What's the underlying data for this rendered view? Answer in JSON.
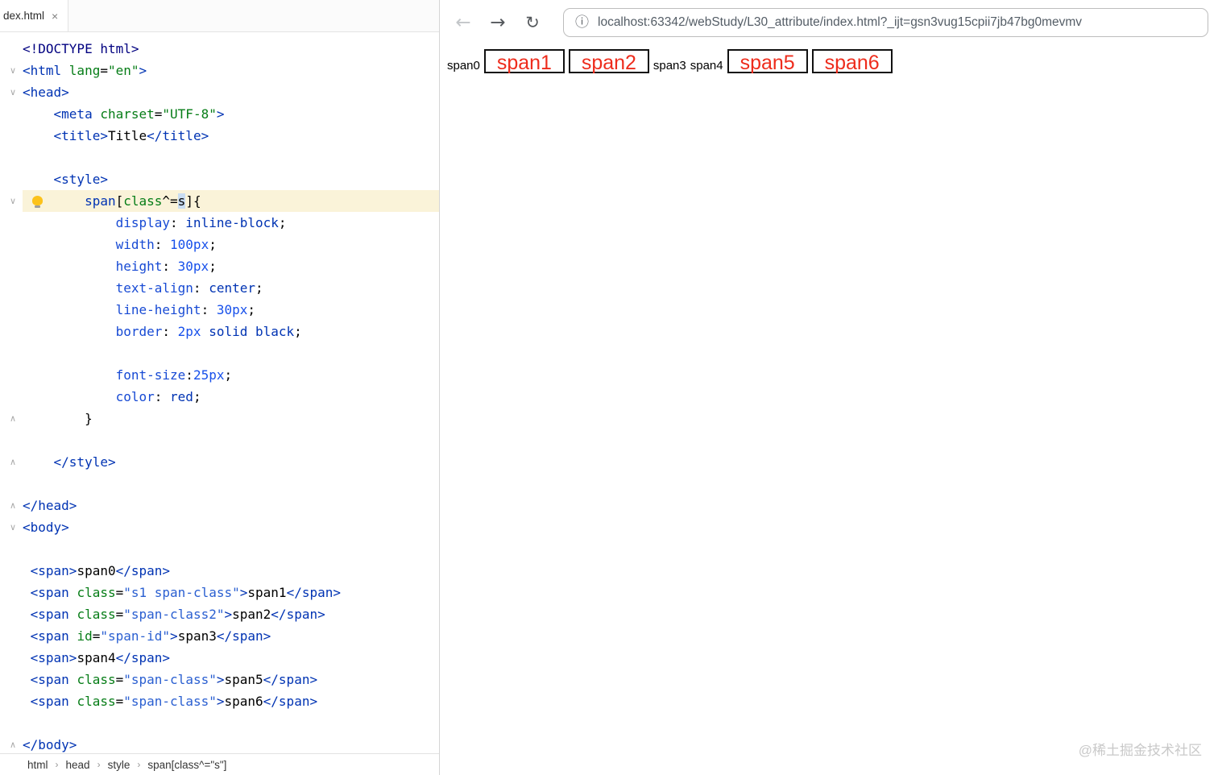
{
  "colors": {
    "doctype": "#000080",
    "tag": "#0033b3",
    "attr_name": "#067d17",
    "attr_value": "#067d17",
    "class_value": "#2a5fd1",
    "css_selector": "#0033b3",
    "css_attr_name": "#067d17",
    "css_property": "#174ad4",
    "css_value": "#0033b3",
    "css_number": "#1750eb",
    "selection_bg": "#c9ddf2",
    "line_highlight": "#faf3d9",
    "red_text": "#ee2c1c",
    "box_border": "#111111",
    "url_text": "#545d66",
    "watermark": "#c9c9c9"
  },
  "editor": {
    "tab": {
      "label": "dex.html",
      "close_icon": "×"
    },
    "icons": {
      "fold_down": "∨",
      "fold_up": "∧"
    },
    "highlight_line": 8,
    "bulb_line": 8,
    "gutter_marks": [
      {
        "line": 2,
        "type": "down"
      },
      {
        "line": 3,
        "type": "down"
      },
      {
        "line": 8,
        "type": "down"
      },
      {
        "line": 18,
        "type": "up"
      },
      {
        "line": 20,
        "type": "up"
      },
      {
        "line": 22,
        "type": "up"
      },
      {
        "line": 23,
        "type": "down"
      },
      {
        "line": 33,
        "type": "up"
      }
    ],
    "lines": [
      {
        "tokens": [
          [
            "doctype",
            "<!DOCTYPE html>"
          ]
        ]
      },
      {
        "tokens": [
          [
            "tag",
            "<html "
          ],
          [
            "attr",
            "lang"
          ],
          [
            "plain",
            "="
          ],
          [
            "str",
            "\"en\""
          ],
          [
            "tag",
            ">"
          ]
        ]
      },
      {
        "tokens": [
          [
            "tag",
            "<head>"
          ]
        ]
      },
      {
        "tokens": [
          [
            "plain",
            "    "
          ],
          [
            "tag",
            "<meta "
          ],
          [
            "attr",
            "charset"
          ],
          [
            "plain",
            "="
          ],
          [
            "str",
            "\"UTF-8\""
          ],
          [
            "tag",
            ">"
          ]
        ]
      },
      {
        "tokens": [
          [
            "plain",
            "    "
          ],
          [
            "tag",
            "<title>"
          ],
          [
            "plain",
            "Title"
          ],
          [
            "tag",
            "</title>"
          ]
        ]
      },
      {
        "tokens": []
      },
      {
        "tokens": [
          [
            "plain",
            "    "
          ],
          [
            "tag",
            "<style>"
          ]
        ]
      },
      {
        "tokens": [
          [
            "plain",
            "        "
          ],
          [
            "cssel",
            "span"
          ],
          [
            "plain",
            "["
          ],
          [
            "cssattr",
            "class"
          ],
          [
            "plain",
            "^="
          ],
          [
            "sel",
            "s"
          ],
          [
            "plain",
            "]{"
          ]
        ]
      },
      {
        "tokens": [
          [
            "plain",
            "            "
          ],
          [
            "prop",
            "display"
          ],
          [
            "plain",
            ": "
          ],
          [
            "val",
            "inline-block"
          ],
          [
            "plain",
            ";"
          ]
        ]
      },
      {
        "tokens": [
          [
            "plain",
            "            "
          ],
          [
            "prop",
            "width"
          ],
          [
            "plain",
            ": "
          ],
          [
            "num",
            "100px"
          ],
          [
            "plain",
            ";"
          ]
        ]
      },
      {
        "tokens": [
          [
            "plain",
            "            "
          ],
          [
            "prop",
            "height"
          ],
          [
            "plain",
            ": "
          ],
          [
            "num",
            "30px"
          ],
          [
            "plain",
            ";"
          ]
        ]
      },
      {
        "tokens": [
          [
            "plain",
            "            "
          ],
          [
            "prop",
            "text-align"
          ],
          [
            "plain",
            ": "
          ],
          [
            "val",
            "center"
          ],
          [
            "plain",
            ";"
          ]
        ]
      },
      {
        "tokens": [
          [
            "plain",
            "            "
          ],
          [
            "prop",
            "line-height"
          ],
          [
            "plain",
            ": "
          ],
          [
            "num",
            "30px"
          ],
          [
            "plain",
            ";"
          ]
        ]
      },
      {
        "tokens": [
          [
            "plain",
            "            "
          ],
          [
            "prop",
            "border"
          ],
          [
            "plain",
            ": "
          ],
          [
            "num",
            "2px"
          ],
          [
            "val",
            " solid black"
          ],
          [
            "plain",
            ";"
          ]
        ]
      },
      {
        "tokens": []
      },
      {
        "tokens": [
          [
            "plain",
            "            "
          ],
          [
            "prop",
            "font-size"
          ],
          [
            "plain",
            ":"
          ],
          [
            "num",
            "25px"
          ],
          [
            "plain",
            ";"
          ]
        ]
      },
      {
        "tokens": [
          [
            "plain",
            "            "
          ],
          [
            "prop",
            "color"
          ],
          [
            "plain",
            ": "
          ],
          [
            "val",
            "red"
          ],
          [
            "plain",
            ";"
          ]
        ]
      },
      {
        "tokens": [
          [
            "plain",
            "        }"
          ]
        ]
      },
      {
        "tokens": []
      },
      {
        "tokens": [
          [
            "plain",
            "    "
          ],
          [
            "tag",
            "</style>"
          ]
        ]
      },
      {
        "tokens": []
      },
      {
        "tokens": [
          [
            "tag",
            "</head>"
          ]
        ]
      },
      {
        "tokens": [
          [
            "tag",
            "<body>"
          ]
        ]
      },
      {
        "tokens": []
      },
      {
        "tokens": [
          [
            "plain",
            " "
          ],
          [
            "tag",
            "<span>"
          ],
          [
            "plain",
            "span0"
          ],
          [
            "tag",
            "</span>"
          ]
        ]
      },
      {
        "tokens": [
          [
            "plain",
            " "
          ],
          [
            "tag",
            "<span "
          ],
          [
            "attr",
            "class"
          ],
          [
            "plain",
            "="
          ],
          [
            "cls",
            "\"s1 span-class\""
          ],
          [
            "tag",
            ">"
          ],
          [
            "plain",
            "span1"
          ],
          [
            "tag",
            "</span>"
          ]
        ]
      },
      {
        "tokens": [
          [
            "plain",
            " "
          ],
          [
            "tag",
            "<span "
          ],
          [
            "attr",
            "class"
          ],
          [
            "plain",
            "="
          ],
          [
            "cls",
            "\"span-class2\""
          ],
          [
            "tag",
            ">"
          ],
          [
            "plain",
            "span2"
          ],
          [
            "tag",
            "</span>"
          ]
        ]
      },
      {
        "tokens": [
          [
            "plain",
            " "
          ],
          [
            "tag",
            "<span "
          ],
          [
            "attr",
            "id"
          ],
          [
            "plain",
            "="
          ],
          [
            "cls",
            "\"span-id\""
          ],
          [
            "tag",
            ">"
          ],
          [
            "plain",
            "span3"
          ],
          [
            "tag",
            "</span>"
          ]
        ]
      },
      {
        "tokens": [
          [
            "plain",
            " "
          ],
          [
            "tag",
            "<span>"
          ],
          [
            "plain",
            "span4"
          ],
          [
            "tag",
            "</span>"
          ]
        ]
      },
      {
        "tokens": [
          [
            "plain",
            " "
          ],
          [
            "tag",
            "<span "
          ],
          [
            "attr",
            "class"
          ],
          [
            "plain",
            "="
          ],
          [
            "cls",
            "\"span-class\""
          ],
          [
            "tag",
            ">"
          ],
          [
            "plain",
            "span5"
          ],
          [
            "tag",
            "</span>"
          ]
        ]
      },
      {
        "tokens": [
          [
            "plain",
            " "
          ],
          [
            "tag",
            "<span "
          ],
          [
            "attr",
            "class"
          ],
          [
            "plain",
            "="
          ],
          [
            "cls",
            "\"span-class\""
          ],
          [
            "tag",
            ">"
          ],
          [
            "plain",
            "span6"
          ],
          [
            "tag",
            "</span>"
          ]
        ]
      },
      {
        "tokens": []
      },
      {
        "tokens": [
          [
            "tag",
            "</body>"
          ]
        ]
      }
    ],
    "breadcrumb_separator": "›",
    "breadcrumb": [
      "html",
      "head",
      "style",
      "span[class^=\"s\"]"
    ]
  },
  "browser": {
    "icons": {
      "back": "←",
      "forward": "→",
      "reload": "↻",
      "info": "ⓘ"
    },
    "url": "localhost:63342/webStudy/L30_attribute/index.html?_ijt=gsn3vug15cpii7jb47bg0mevmv",
    "content": [
      {
        "text": "span0",
        "boxed": false
      },
      {
        "text": "span1",
        "boxed": true
      },
      {
        "text": "span2",
        "boxed": true
      },
      {
        "text": "span3",
        "boxed": false
      },
      {
        "text": "span4",
        "boxed": false
      },
      {
        "text": "span5",
        "boxed": true
      },
      {
        "text": "span6",
        "boxed": true
      }
    ],
    "watermark": "@稀土掘金技术社区"
  }
}
